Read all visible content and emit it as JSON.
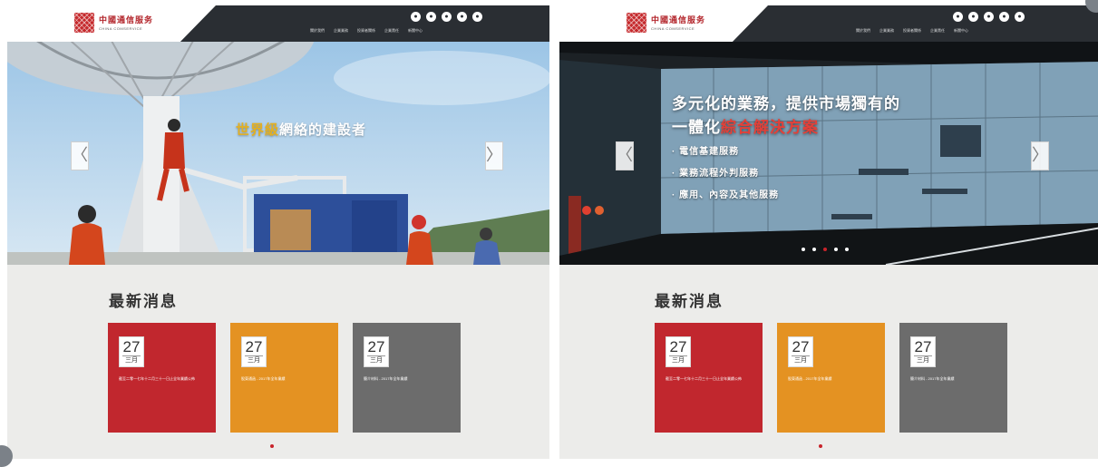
{
  "header": {
    "logo_cn": "中國通信服务",
    "logo_en": "CHINA COMSERVICE",
    "social_icons": [
      "weibo-icon",
      "wechat-icon",
      "share-icon",
      "mail-icon",
      "search-icon"
    ],
    "social_glyphs": [
      "●",
      "●",
      "●",
      "●",
      "●"
    ],
    "nav": [
      "關於我們",
      "企業業務",
      "投資者關係",
      "企業責任",
      "新聞中心"
    ]
  },
  "slide1": {
    "headline_highlight": "世界級",
    "headline_rest": "網絡的建設者"
  },
  "slide2": {
    "title_line1": "多元化的業務，提供市場獨有的",
    "title_line2_prefix": "一體化",
    "title_line2_highlight": "綜合解決方案",
    "bullets": [
      "· 電信基建服務",
      "· 業務流程外判服務",
      "· 應用、內容及其他服務"
    ]
  },
  "slider": {
    "prev_glyph": "〈",
    "next_glyph": "〉",
    "pager_count": 5,
    "active_index": 2
  },
  "news": {
    "title": "最新消息",
    "items": [
      {
        "day": "27",
        "month": "三月",
        "text": "截至二零一七年十二月三十一日止全年業績公佈"
      },
      {
        "day": "27",
        "month": "三月",
        "text": "股東通函 - 2017年全年業績"
      },
      {
        "day": "27",
        "month": "三月",
        "text": "簡介材料 - 2017年全年業績"
      }
    ]
  },
  "colors": {
    "brand_red": "#c1272e",
    "orange": "#e49222",
    "gray": "#6c6c6c",
    "header_bg": "#2a2e33"
  }
}
